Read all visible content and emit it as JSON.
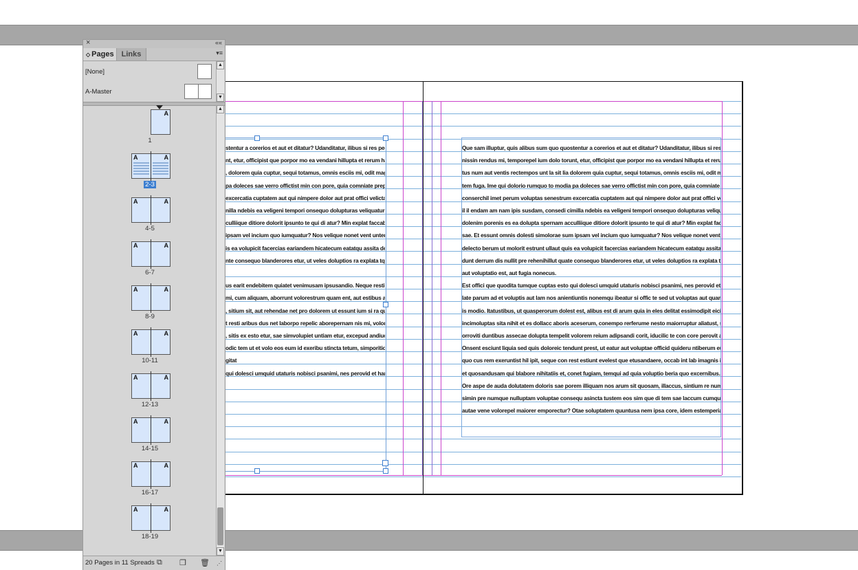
{
  "pasteboard": {
    "band_color": "#a6a6a6"
  },
  "panel": {
    "close_glyph": "×",
    "collapse_glyph": "««",
    "tabs": [
      {
        "label": "Pages",
        "active": true
      },
      {
        "label": "Links",
        "active": false
      }
    ],
    "menu_glyph": "▾≡",
    "masters": [
      {
        "label": "[None]",
        "pages": 1
      },
      {
        "label": "A-Master",
        "pages": 2
      }
    ],
    "spreads": [
      {
        "label": "1",
        "pages": 1,
        "masters": [
          "A"
        ],
        "selected": false
      },
      {
        "label": "2-3",
        "pages": 2,
        "masters": [
          "A",
          "A"
        ],
        "selected": true
      },
      {
        "label": "4-5",
        "pages": 2,
        "masters": [
          "A",
          "A"
        ],
        "selected": false
      },
      {
        "label": "6-7",
        "pages": 2,
        "masters": [
          "A",
          "A"
        ],
        "selected": false
      },
      {
        "label": "8-9",
        "pages": 2,
        "masters": [
          "A",
          "A"
        ],
        "selected": false
      },
      {
        "label": "10-11",
        "pages": 2,
        "masters": [
          "A",
          "A"
        ],
        "selected": false
      },
      {
        "label": "12-13",
        "pages": 2,
        "masters": [
          "A",
          "A"
        ],
        "selected": false
      },
      {
        "label": "14-15",
        "pages": 2,
        "masters": [
          "A",
          "A"
        ],
        "selected": false
      },
      {
        "label": "16-17",
        "pages": 2,
        "masters": [
          "A",
          "A"
        ],
        "selected": false
      },
      {
        "label": "18-19",
        "pages": 2,
        "masters": [
          "A",
          "A"
        ],
        "selected": false
      }
    ],
    "status": "20 Pages in 11 Spreads",
    "icons": [
      "page-size-icon",
      "new-page-icon",
      "trash-icon"
    ],
    "accent": "#3d7fd0"
  },
  "document": {
    "left_page_lines": [
      "stentur a corerios et aut et ditatur? Udanditatur, ilibus si res ped mag-",
      "nt, etur, officipist que porpor mo ea vendani hillupta et rerum harup-",
      ", dolorem quia cuptur, sequi totamus, omnis esciis mi, odit magnihic",
      "pa doleces sae verro offictist min con pore, quia comniate prepel etur,",
      "excercatia cuptatem aut qui nimpere dolor aut prat offici velictatiis et",
      "nilla ndebis ea veligeni tempori onsequo dolupturas veliquatur? Ame",
      "culliique ditiore dolorit ipsunto te qui di atur? Min explat faccabo ribu-",
      " ipsam vel incium quo iumquatur? Nos velique nonet vent untem quo",
      "is ea volupicit facercias eariandem hicatecum eatatqu assita desequi-",
      "nte consequo blanderores etur, ut veles doluptios ra explata tquatur",
      "",
      "us earit endebitem quiatet venimusam ipsusandio. Neque resti conse-",
      "mi, cum aliquam, aborrunt volorestrum quam ent, aut estibus antiur",
      ", sitium sit, aut rehendae net pro dolorem ut essunt ium si ra quis en-",
      "t resti aribus dus net laborpo repelic aborepernam nis mi, voloresequi",
      ", sitis ex esto etur, sae simvolupiet untiam etur, excepud andiucilibus",
      "odic tem ut et volo eos eum id exeribu stincta tetum, simporitio que",
      "gitat",
      "qui dolesci umquid utaturis nobisci psanimi, nes perovid et harchil"
    ],
    "right_page_lines": [
      "Que sam illuptur, quis alibus sum quo quostentur a corerios et aut et ditatur? Udanditatur, ilibus si res ped mag-",
      "nissin rendus mi, temporepel ium dolo torunt, etur, officipist que porpor mo ea vendani hillupta et rerum harup-",
      "tus num aut ventis rectempos unt la sit lia dolorem quia cuptur, sequi totamus, omnis esciis mi, odit magnihic",
      "tem fuga. Ime qui dolorio rumquo to modia pa doleces sae verro offictist min con pore, quia comniate prepel etur,",
      "conserchil imet perum voluptas senestrum excercatia cuptatem aut qui nimpere dolor aut prat offici velictatiis et",
      "il il endam am nam ipis susdam, consedi cimilla ndebis ea veligeni tempori onsequo dolupturas veliquatur? Ame",
      "dolenim porenis es ea dolupta spernam acculliique ditiore dolorit ipsunto te qui di atur? Min explat faccabo ribu-",
      "sae. Et essunt omnis dolesti simolorae sum ipsam vel incium quo iumquatur? Nos velique nonet vent untem quo",
      "delecto berum ut molorit estrunt ullaut quis ea volupicit facercias eariandem hicatecum eatatqu assita desequi-",
      "dunt derrum dis nullit pre rehenihillut quate consequo blanderores etur, ut veles doluptios ra explata tquatur",
      "aut voluptatio est, aut fugia nonecus.",
      "Est offici que quodita tumque cuptas esto qui dolesci umquid utaturis nobisci psanimi, nes perovid et harchilit",
      "late parum ad et voluptis aut lam nos anientiuntis nonemqu ibeatur si offic te sed ut voluptas aut quam venis",
      "is modio. Itatustibus, ut quasperorum dolest est, alibus est di arum quia in eles delitat essimodipit eicijs et resi",
      "incimoluptas sita nihit et es dollacc aboris aceserum, conempo rerferume nesto maiorruptur aliatust, sequis vol-",
      "orroviti duntibus assecae dolupta tempelit volorem reium adipsandi corit, iducilic te con core perovit aditatur?",
      "Onsent esciunt liquia sed quis doloreic tendunt prest, ut eatur aut voluptae officid quideru ntiberum eumendem",
      "quo cus rem exeruntist hil ipit, seque con rest estiunt evelest que etusandaere, occab int lab imagnis inctur re con",
      "et quosandusam qui blabore nihitatiis et, conet fugiam, temqui ad quia voluptio beria quo excernibus.",
      "Ore aspe de auda dolutatem doloris sae porem illiquam nos arum sit quosam, illaccus, sintium re numqui berum",
      "simin pre numque nulluptam voluptae consequ asincta tustem eos sim que di tem sae laccum cumquis prempor",
      "autae vene volorepel maiorer emporectur? Otae soluptatem quuntusa nem ipsa core, idem estemperiat doluptatem"
    ]
  }
}
